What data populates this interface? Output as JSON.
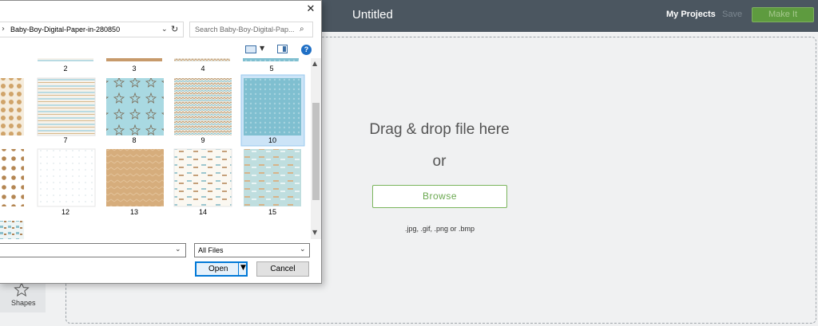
{
  "app": {
    "title": "Untitled",
    "my_projects": "My Projects",
    "save": "Save",
    "make_it": "Make It"
  },
  "sidebar": {
    "shapes_label": "Shapes"
  },
  "upload": {
    "title": "Drag & drop file here",
    "or": "or",
    "browse": "Browse",
    "formats": ".jpg, .gif, .png or .bmp"
  },
  "dialog": {
    "close": "✕",
    "path": "Baby-Boy-Digital-Paper-in-280850",
    "search_placeholder": "Search Baby-Boy-Digital-Pap...",
    "help": "?",
    "top_row_labels": [
      "2",
      "3",
      "4",
      "5"
    ],
    "thumbnails": [
      {
        "label": "7"
      },
      {
        "label": "8"
      },
      {
        "label": "9"
      },
      {
        "label": "10",
        "selected": true
      },
      {
        "label": "12"
      },
      {
        "label": "13"
      },
      {
        "label": "14"
      },
      {
        "label": "15"
      }
    ],
    "filename_value": "",
    "filter": "All Files",
    "open": "Open",
    "cancel": "Cancel"
  },
  "colors": {
    "header_bg": "#4b5660",
    "accent_green": "#6aa84f",
    "make_it_bg": "#5e9b3f",
    "selection": "#cce4f7",
    "dialog_accent": "#0078d7"
  }
}
